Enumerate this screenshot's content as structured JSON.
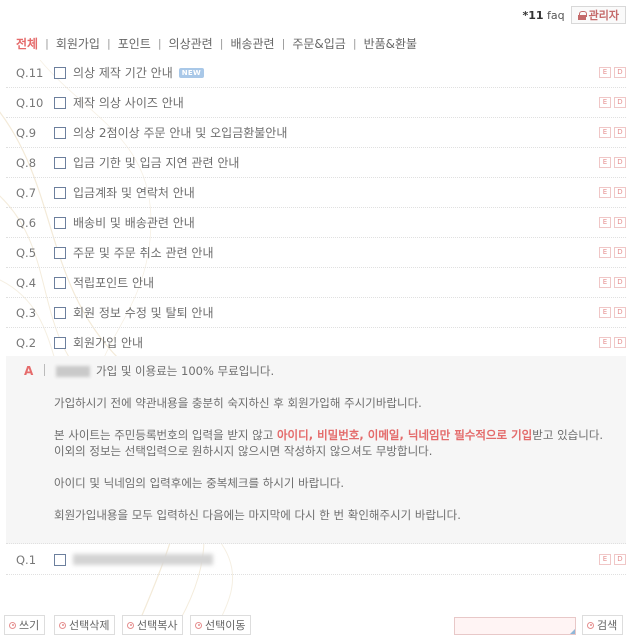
{
  "header": {
    "count_prefix": "*11",
    "count_suffix": "faq",
    "admin_label": "관리자"
  },
  "categories": [
    {
      "label": "전체",
      "active": true
    },
    {
      "label": "회원가입"
    },
    {
      "label": "포인트"
    },
    {
      "label": "의상관련"
    },
    {
      "label": "배송관련"
    },
    {
      "label": "주문&입금"
    },
    {
      "label": "반품&환불"
    }
  ],
  "faq": [
    {
      "num": "Q.11",
      "subject": "의상 제작 기간 안내",
      "badge": "NEW"
    },
    {
      "num": "Q.10",
      "subject": "제작 의상 사이즈 안내"
    },
    {
      "num": "Q.9",
      "subject": "의상 2점이상 주문 안내 및 오입금환불안내"
    },
    {
      "num": "Q.8",
      "subject": "입금 기한 및 입금 지연 관련 안내"
    },
    {
      "num": "Q.7",
      "subject": "입금계좌 및 연락처 안내"
    },
    {
      "num": "Q.6",
      "subject": "배송비 및 배송관련 안내"
    },
    {
      "num": "Q.5",
      "subject": "주문 및 주문 취소 관련 안내"
    },
    {
      "num": "Q.4",
      "subject": "적립포인트 안내"
    },
    {
      "num": "Q.3",
      "subject": "회원 정보 수정 및 탈퇴 안내"
    },
    {
      "num": "Q.2",
      "subject": "회원가입 안내"
    }
  ],
  "row_actions": {
    "edit": "E",
    "delete": "D"
  },
  "answer": {
    "label": "A",
    "line1": "가입 및 이용료는 100% 무료입니다.",
    "line2": "가입하시기 전에 약관내용을 충분히 숙지하신 후 회원가입해 주시기바랍니다.",
    "line3_pre": "본 사이트는 주민등록번호의 입력을 받지 않고 ",
    "line3_hl": "아이디, 비밀번호, 이메일, 닉네임만 필수적으로 기입",
    "line3_post": "받고 있습니다.",
    "line4": "이외의 정보는 선택입력으로 원하시지 않으시면 작성하지 않으셔도 무방합니다.",
    "line5": "아이디 및 닉네임의 입력후에는 중복체크를 하시기 바랍니다.",
    "line6": "회원가입내용을 모두 입력하신 다음에는 마지막에 다시 한 번 확인해주시기 바랍니다."
  },
  "last_row": {
    "num": "Q.1"
  },
  "bottom": {
    "write": "쓰기",
    "delete_selected": "선택삭제",
    "copy_selected": "선택복사",
    "move_selected": "선택이동",
    "search": "검색"
  },
  "colors": {
    "accent": "#e56b6b",
    "answer_bg": "#f6f6f6"
  }
}
